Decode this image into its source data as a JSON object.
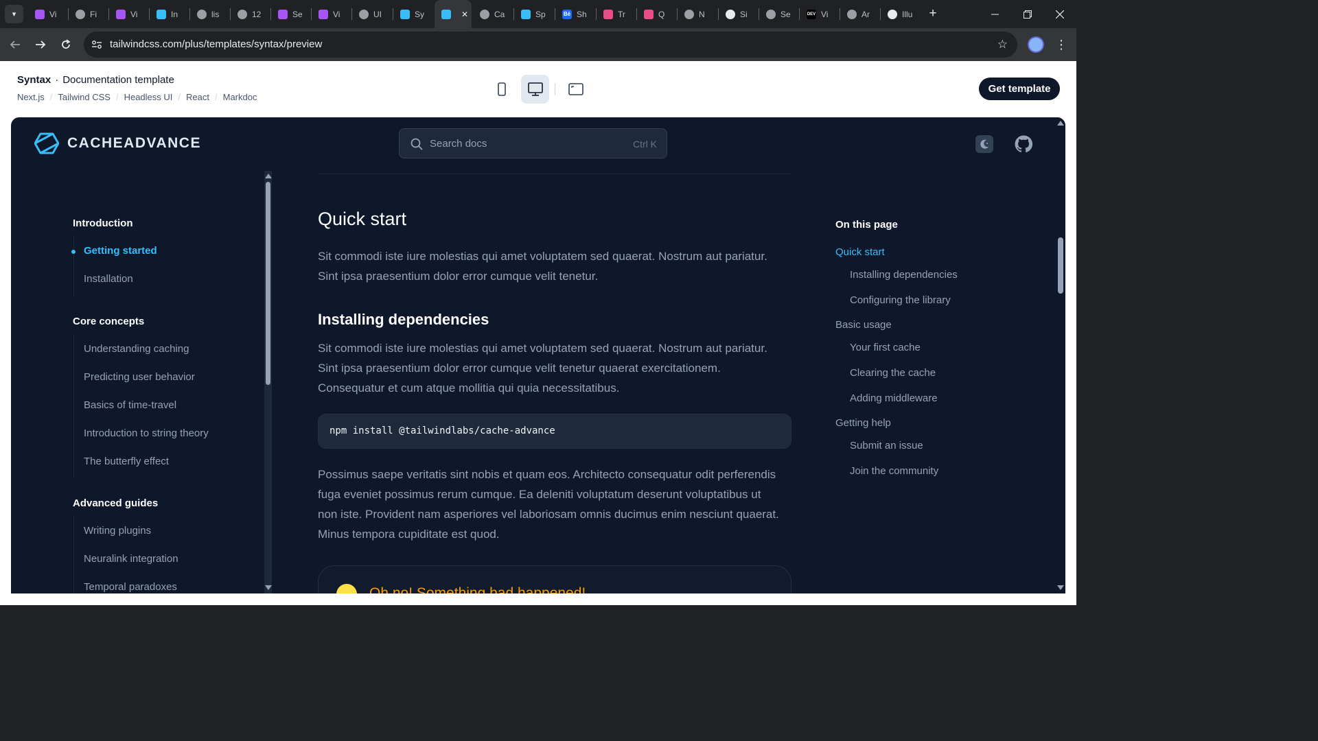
{
  "browser": {
    "tabs": [
      {
        "label": "Vi",
        "favicon": "vite-icon",
        "color": "#a855f7"
      },
      {
        "label": "Fi",
        "favicon": "globe-icon",
        "color": "#9aa0a6"
      },
      {
        "label": "Vi",
        "favicon": "vite-icon",
        "color": "#a855f7"
      },
      {
        "label": "In",
        "favicon": "tailwind-icon",
        "color": "#38bdf8"
      },
      {
        "label": "lis",
        "favicon": "globe-icon",
        "color": "#9aa0a6"
      },
      {
        "label": "12",
        "favicon": "globe-icon",
        "color": "#9aa0a6"
      },
      {
        "label": "Se",
        "favicon": "vite-icon",
        "color": "#a855f7"
      },
      {
        "label": "Vi",
        "favicon": "vite-icon",
        "color": "#a855f7"
      },
      {
        "label": "UI",
        "favicon": "globe-icon",
        "color": "#9aa0a6"
      },
      {
        "label": "Sy",
        "favicon": "tailwind-icon",
        "color": "#38bdf8"
      },
      {
        "label": "",
        "favicon": "tailwind-icon",
        "color": "#38bdf8"
      },
      {
        "label": "Ca",
        "favicon": "globe-icon",
        "color": "#9aa0a6"
      },
      {
        "label": "Sp",
        "favicon": "tailwind-icon",
        "color": "#38bdf8"
      },
      {
        "label": "Sh",
        "favicon": "behance-icon",
        "color": "#1769ff"
      },
      {
        "label": "Tr",
        "favicon": "dribbble-icon",
        "color": "#ea4c89"
      },
      {
        "label": "Q",
        "favicon": "dribbble-icon",
        "color": "#ea4c89"
      },
      {
        "label": "N",
        "favicon": "globe-icon",
        "color": "#9aa0a6"
      },
      {
        "label": "Si",
        "favicon": "github-icon",
        "color": "#e8eaed"
      },
      {
        "label": "Se",
        "favicon": "globe-icon",
        "color": "#9aa0a6"
      },
      {
        "label": "Vi",
        "favicon": "dev-icon",
        "color": "#000000"
      },
      {
        "label": "Ar",
        "favicon": "globe-icon",
        "color": "#9aa0a6"
      },
      {
        "label": "Illu",
        "favicon": "avatar-icon",
        "color": "#e8eaed"
      }
    ],
    "url": "tailwindcss.com/plus/templates/syntax/preview"
  },
  "template": {
    "name": "Syntax",
    "separator": "·",
    "subtitle": "Documentation template",
    "tech": [
      "Next.js",
      "Tailwind CSS",
      "Headless UI",
      "React",
      "Markdoc"
    ],
    "tech_sep": "/",
    "cta": "Get template"
  },
  "site": {
    "brand": "CACHEADVANCE",
    "search_placeholder": "Search docs",
    "search_shortcut": "Ctrl K",
    "accent": "#38bdf8"
  },
  "sidebar": {
    "sections": [
      {
        "title": "Introduction",
        "items": [
          "Getting started",
          "Installation"
        ]
      },
      {
        "title": "Core concepts",
        "items": [
          "Understanding caching",
          "Predicting user behavior",
          "Basics of time-travel",
          "Introduction to string theory",
          "The butterfly effect"
        ]
      },
      {
        "title": "Advanced guides",
        "items": [
          "Writing plugins",
          "Neuralink integration",
          "Temporal paradoxes"
        ]
      }
    ],
    "active": "Getting started"
  },
  "article": {
    "title": "Quick start",
    "intro_line1": "Sit commodi iste iure molestias qui amet voluptatem sed quaerat. Nostrum aut pariatur.",
    "intro_line2": "Sint ipsa praesentium dolor error cumque velit tenetur.",
    "h2": "Installing dependencies",
    "p2_line1": "Sit commodi iste iure molestias qui amet voluptatem sed quaerat. Nostrum aut pariatur.",
    "p2_line2": "Sint ipsa praesentium dolor error cumque velit tenetur quaerat exercitationem.",
    "p2_line3": "Consequatur et cum atque mollitia qui quia necessitatibus.",
    "code": "npm install @tailwindlabs/cache-advance",
    "p3_line1": "Possimus saepe veritatis sint nobis et quam eos. Architecto consequatur odit perferendis",
    "p3_line2": "fuga eveniet possimus rerum cumque. Ea deleniti voluptatum deserunt voluptatibus ut",
    "p3_line3": "non iste. Provident nam asperiores vel laboriosam omnis ducimus enim nesciunt quaerat.",
    "p3_line4": "Minus tempora cupiditate est quod.",
    "callout_title": "Oh no! Something bad happened!"
  },
  "toc": {
    "title": "On this page",
    "items": [
      {
        "label": "Quick start",
        "level": 1,
        "active": true
      },
      {
        "label": "Installing dependencies",
        "level": 2
      },
      {
        "label": "Configuring the library",
        "level": 2
      },
      {
        "label": "Basic usage",
        "level": 1
      },
      {
        "label": "Your first cache",
        "level": 2
      },
      {
        "label": "Clearing the cache",
        "level": 2
      },
      {
        "label": "Adding middleware",
        "level": 2
      },
      {
        "label": "Getting help",
        "level": 1
      },
      {
        "label": "Submit an issue",
        "level": 2
      },
      {
        "label": "Join the community",
        "level": 2
      }
    ]
  }
}
